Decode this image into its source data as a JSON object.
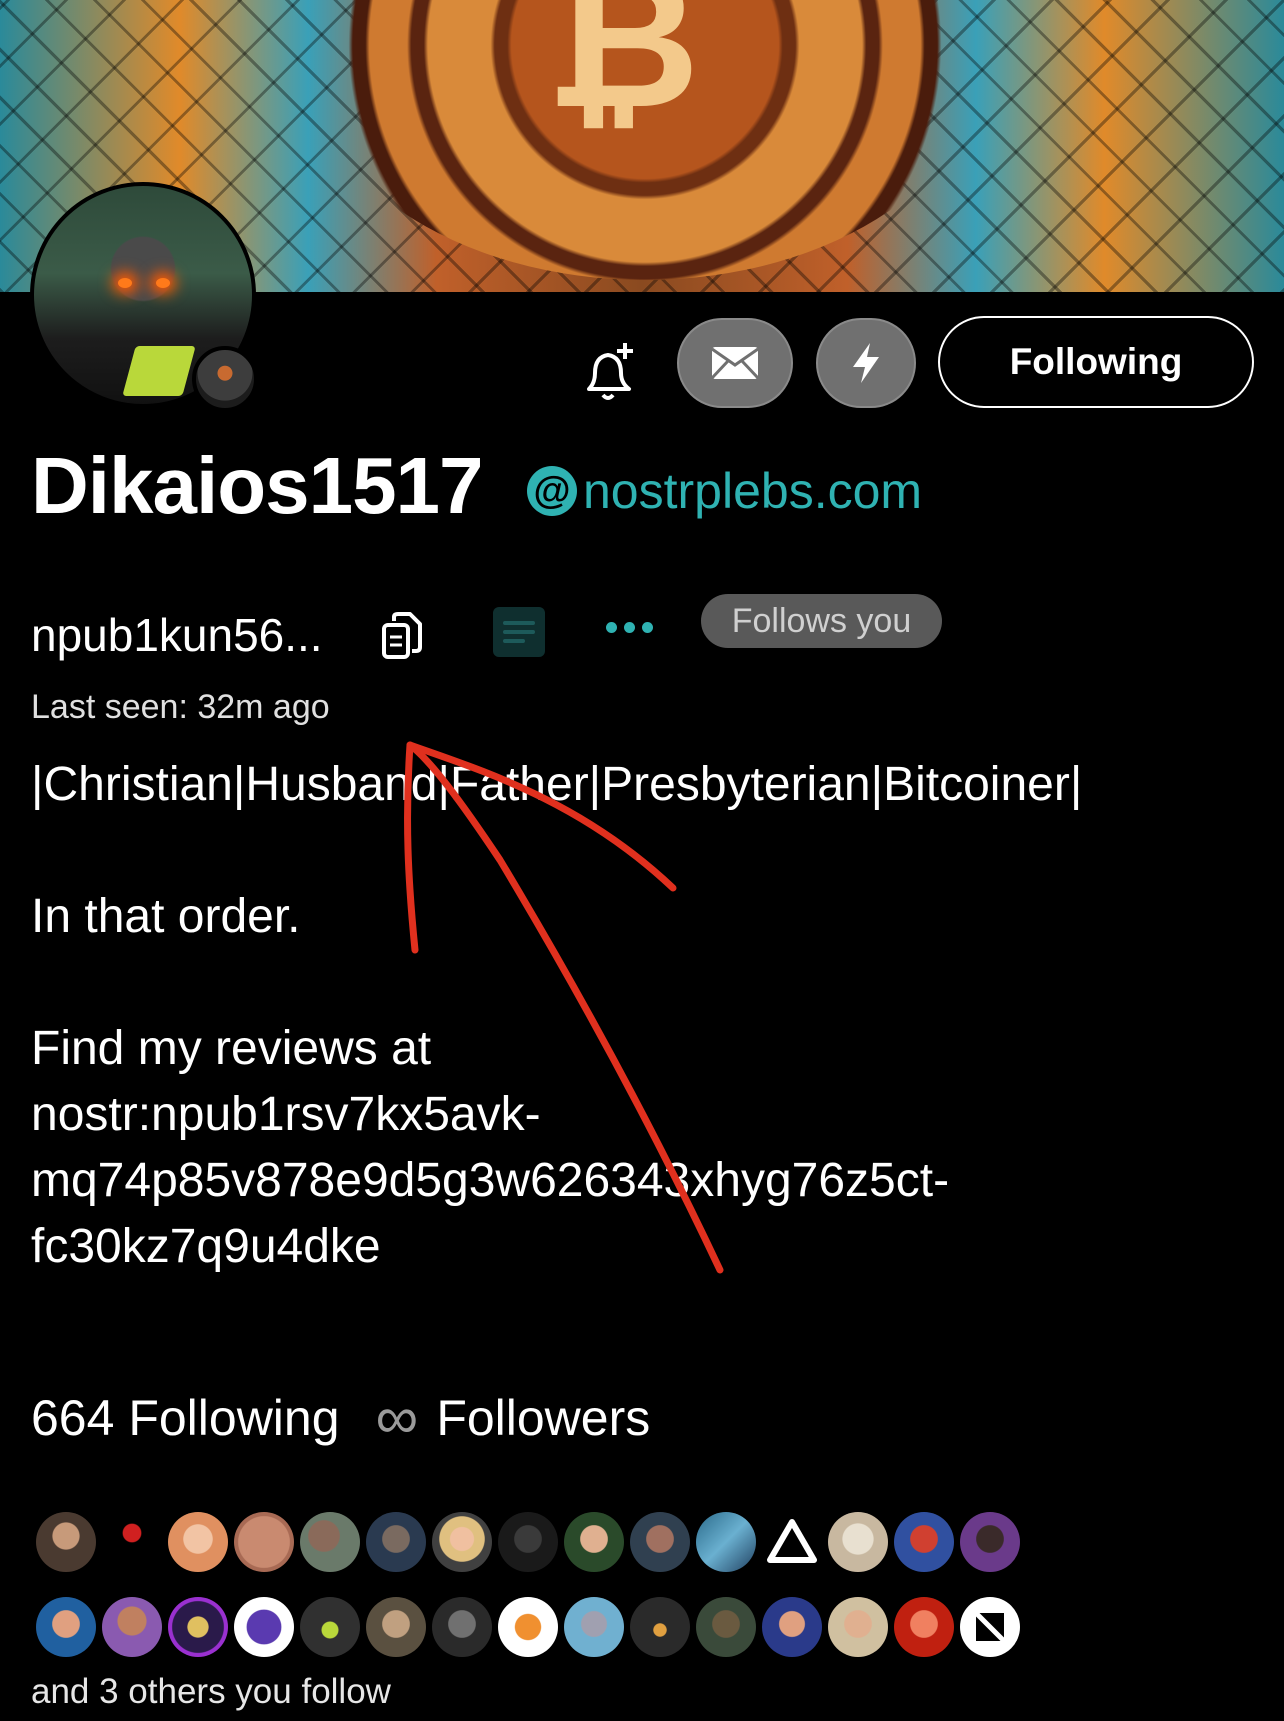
{
  "profile": {
    "display_name": "Dikaios1517",
    "nip05_domain": "nostrplebs.com",
    "nip05_at": "@",
    "npub_short": "npub1kun56...",
    "follows_you_label": "Follows you",
    "last_seen": "Last seen: 32m ago"
  },
  "actions": {
    "following_label": "Following"
  },
  "about": {
    "line1": "|Christian|Husband|Father|Presbyterian|Bitcoiner|",
    "line2": "In that order.",
    "line3": "Find my reviews at",
    "line4": "nostr:npub1rsv7kx5avk-",
    "line5": "mq74p85v878e9d5g3w626343xhyg76z5ct-",
    "line6": "fc30kz7q9u4dke"
  },
  "counts": {
    "following": "664 Following",
    "infinity_symbol": "∞",
    "followers": "Followers"
  },
  "followed_by": {
    "others_text": "and 3 others you follow"
  },
  "colors": {
    "accent": "#2fb2b2",
    "annotation": "#e0301e",
    "pill": "#595959"
  },
  "icons": [
    "bell-plus-icon",
    "envelope-icon",
    "lightning-icon",
    "copy-icon",
    "qr-code-icon",
    "more-dots-icon",
    "infinity-icon"
  ]
}
